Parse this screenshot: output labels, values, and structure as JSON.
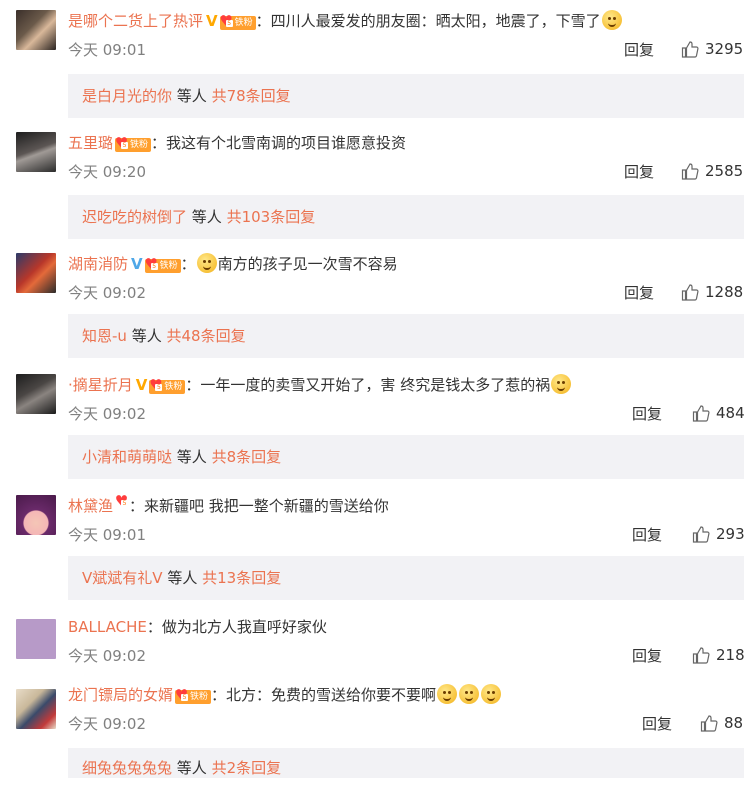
{
  "comments": [
    {
      "username": "是哪个二货上了热评",
      "verified": "V",
      "fan_badge": "铁粉",
      "text": "四川人最爱发的朋友圈：晒太阳，地震了，下雪了",
      "emoji_icons": [
        "grin-emoji"
      ],
      "time": "今天 09:01",
      "reply_label": "回复",
      "likes": "3295",
      "sub_name": "是白月光的你",
      "sub_etc": "等人",
      "sub_count": "共78条回复",
      "avatar_colors": [
        "#3a2f2a",
        "#d9b89a"
      ]
    },
    {
      "username": "五里璐",
      "verified": "",
      "fan_badge": "铁粉",
      "text": "我这有个北雪南调的项目谁愿意投资",
      "emoji_icons": [],
      "time": "今天 09:20",
      "reply_label": "回复",
      "likes": "2585",
      "sub_name": "迟吃吃的树倒了",
      "sub_etc": "等人",
      "sub_count": "共103条回复",
      "avatar_colors": [
        "#2a2a2a",
        "#a09a96"
      ]
    },
    {
      "username": "湖南消防",
      "verified": "V",
      "fan_badge": "铁粉",
      "text": "南方的孩子见一次雪不容易",
      "emoji_icons": [
        "tears-of-joy-emoji"
      ],
      "time": "今天 09:02",
      "reply_label": "回复",
      "likes": "1288",
      "sub_name": "知恩-u",
      "sub_etc": "等人",
      "sub_count": "共48条回复",
      "avatar_colors": [
        "#b8372a",
        "#2b3b6a"
      ]
    },
    {
      "username": "·摘星折月",
      "verified": "V",
      "fan_badge": "铁粉",
      "text": "一年一度的卖雪又开始了，害 终究是钱太多了惹的祸",
      "emoji_icons": [
        "cat-emoji"
      ],
      "time": "今天 09:02",
      "reply_label": "回复",
      "likes": "484",
      "sub_name": "小清和萌萌哒",
      "sub_etc": "等人",
      "sub_count": "共8条回复",
      "avatar_colors": [
        "#1d1d1d",
        "#8a8480"
      ]
    },
    {
      "username": "林黛渔",
      "verified": "",
      "fan_badge": "",
      "text": "来新疆吧  我把一整个新疆的雪送给你",
      "emoji_icons": [],
      "time": "今天 09:01",
      "reply_label": "回复",
      "likes": "293",
      "sub_name": "V斌斌有礼V",
      "sub_etc": "等人",
      "sub_count": "共13条回复",
      "avatar_colors": [
        "#6a2a6a",
        "#f4b6b6"
      ]
    },
    {
      "username": "BALLACHE",
      "verified": "",
      "fan_badge": "",
      "text": "做为北方人我直呼好家伙",
      "emoji_icons": [],
      "time": "今天 09:02",
      "reply_label": "回复",
      "likes": "218",
      "sub_name": "",
      "sub_etc": "",
      "sub_count": "",
      "avatar_colors": [
        "#b79ac8",
        "#b79ac8"
      ]
    },
    {
      "username": "龙门镖局的女婿",
      "verified": "",
      "fan_badge": "铁粉",
      "text": "北方：免费的雪送给你要不要啊",
      "emoji_icons": [
        "smile-emoji",
        "smile-emoji",
        "smile-emoji"
      ],
      "time": "今天 09:02",
      "reply_label": "回复",
      "likes": "88",
      "sub_name": "细兔兔兔兔兔",
      "sub_etc": "等人",
      "sub_count": "共2条回复",
      "avatar_colors": [
        "#c9b89a",
        "#3a4a6a"
      ]
    }
  ],
  "colors": {
    "link": "#eb7350",
    "time": "#808080",
    "subbox_bg": "#f2f2f5",
    "verified": "#ffa800",
    "fan_badge": "#ff9f2e"
  }
}
